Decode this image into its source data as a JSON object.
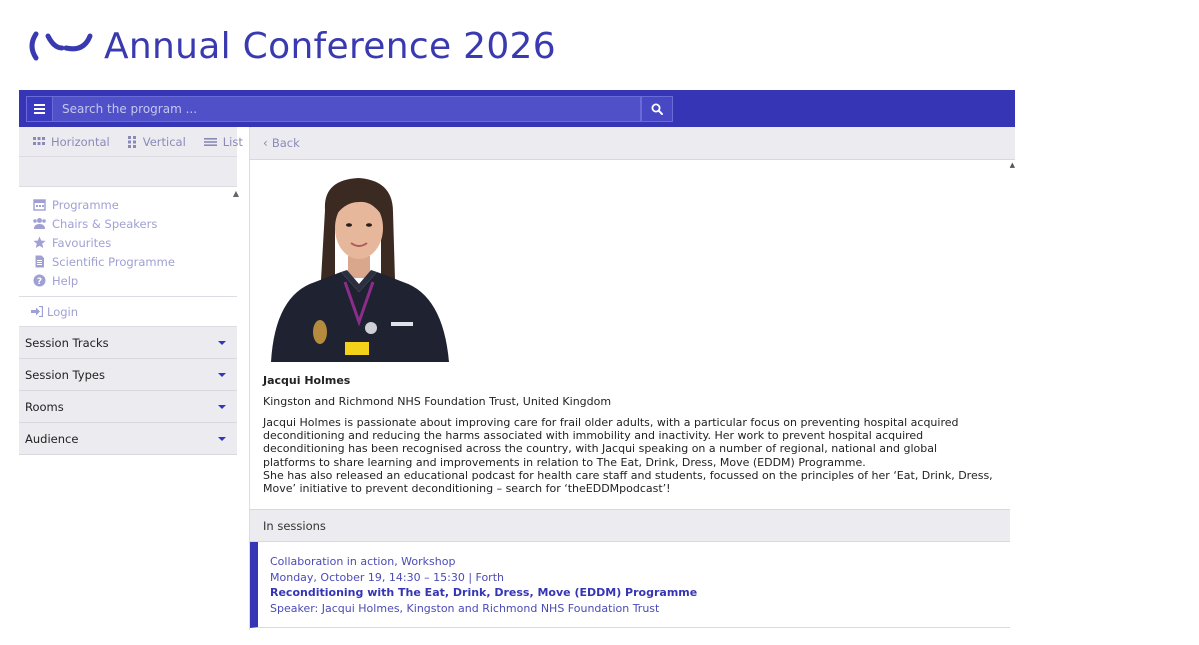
{
  "brand": {
    "title": "Annual Conference 2026",
    "color": "#3a3ab0"
  },
  "topbar": {
    "search_placeholder": "Search the program ...",
    "accent": "#3535b5"
  },
  "views": [
    {
      "label": "Horizontal",
      "icon": "grid-icon"
    },
    {
      "label": "Vertical",
      "icon": "columns-icon"
    },
    {
      "label": "List",
      "icon": "list-icon"
    }
  ],
  "nav": [
    {
      "label": "Programme",
      "icon": "calendar-icon"
    },
    {
      "label": "Chairs & Speakers",
      "icon": "users-icon"
    },
    {
      "label": "Favourites",
      "icon": "star-icon"
    },
    {
      "label": "Scientific Programme",
      "icon": "document-icon"
    },
    {
      "label": "Help",
      "icon": "help-icon"
    }
  ],
  "login": {
    "label": "Login",
    "icon": "login-icon"
  },
  "filters": [
    {
      "label": "Session Tracks"
    },
    {
      "label": "Session Types"
    },
    {
      "label": "Rooms"
    },
    {
      "label": "Audience"
    }
  ],
  "back": {
    "label": "Back"
  },
  "speaker": {
    "name": "Jacqui Holmes",
    "affiliation": "Kingston and Richmond NHS Foundation Trust, United Kingdom",
    "bio_1": "Jacqui Holmes is passionate about improving care for frail older adults, with a particular focus on preventing hospital acquired deconditioning and reducing the harms associated with immobility and inactivity. Her work to prevent hospital acquired deconditioning has been recognised across the country, with Jacqui speaking on a number of regional, national and global platforms to share learning and improvements in relation to The Eat, Drink, Dress, Move (EDDM) Programme.",
    "bio_2": "She has also released an educational podcast for health care staff and students, focussed on the principles of her ‘Eat, Drink, Dress, Move’ initiative to prevent deconditioning – search for ‘theEDDMpodcast’!"
  },
  "sessions_heading": "In sessions",
  "sessions": [
    {
      "track": "Collaboration in action, Workshop",
      "when": "Monday, October 19, 14:30 – 15:30 | Forth",
      "title": "Reconditioning with The Eat, Drink, Dress, Move (EDDM) Programme",
      "speaker": "Speaker: Jacqui Holmes, Kingston and Richmond NHS Foundation Trust"
    }
  ]
}
